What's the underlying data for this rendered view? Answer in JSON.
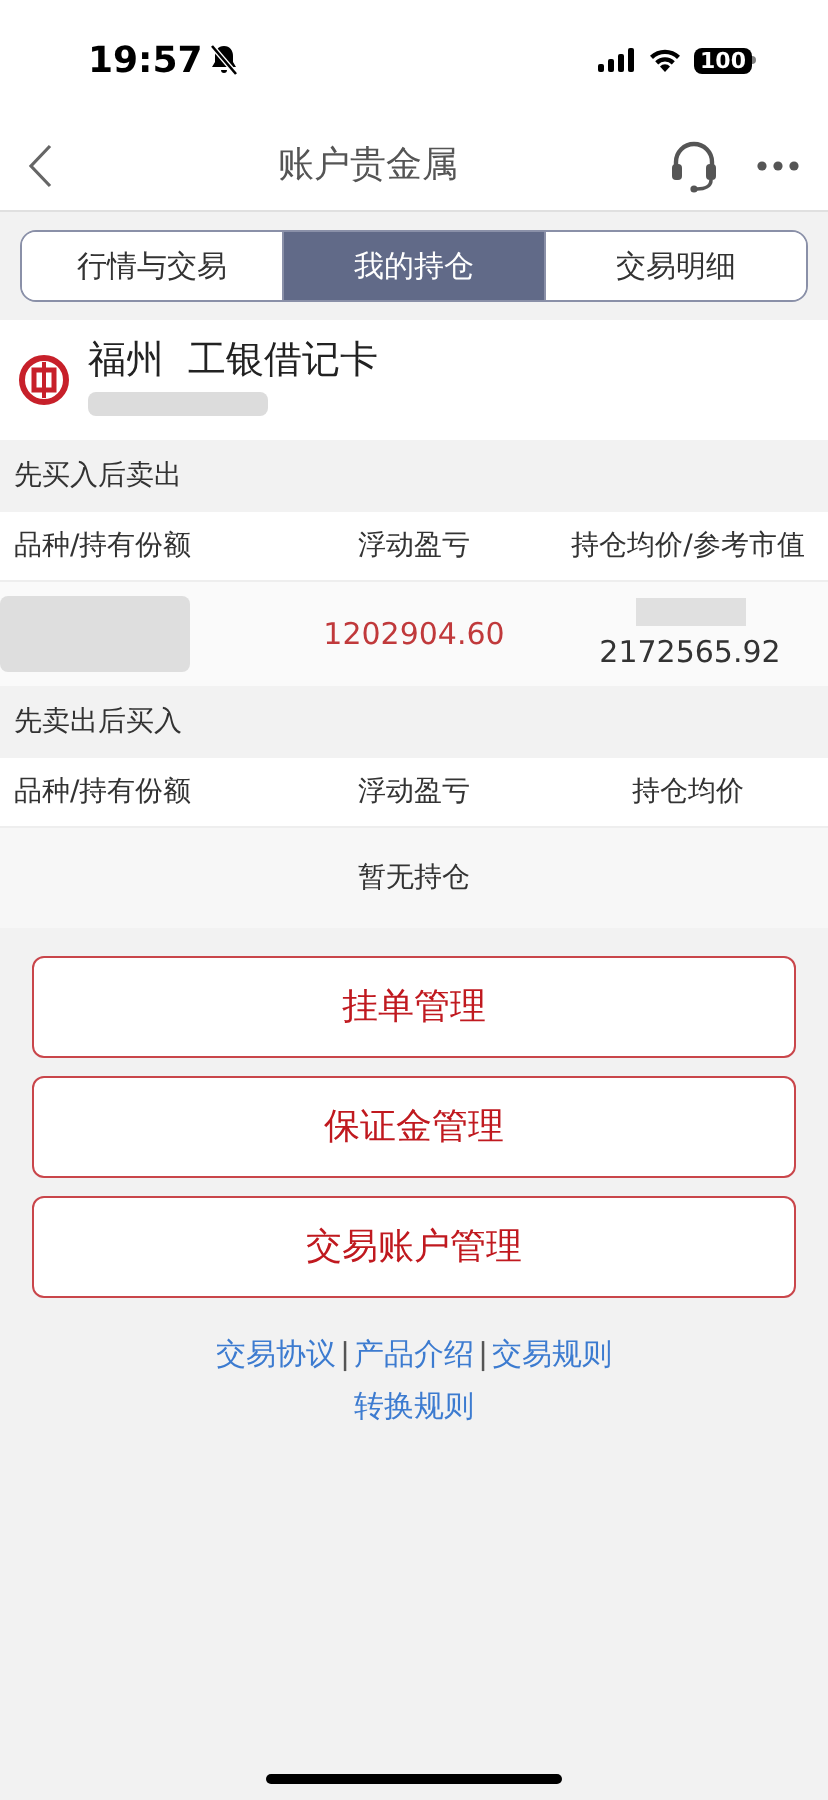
{
  "status_bar": {
    "time": "19:57",
    "battery": "100"
  },
  "nav": {
    "title": "账户贵金属"
  },
  "tabs": [
    {
      "label": "行情与交易",
      "selected": false
    },
    {
      "label": "我的持仓",
      "selected": true
    },
    {
      "label": "交易明细",
      "selected": false
    }
  ],
  "account": {
    "name": "福州  工银借记卡"
  },
  "sections": [
    {
      "title": "先买入后卖出",
      "columns": [
        "品种/持有份额",
        "浮动盈亏",
        "持仓均价/参考市值"
      ],
      "rows": [
        {
          "profit": "1202904.60",
          "market_value": "2172565.92"
        }
      ]
    },
    {
      "title": "先卖出后买入",
      "columns": [
        "品种/持有份额",
        "浮动盈亏",
        "持仓均价"
      ],
      "empty_text": "暂无持仓"
    }
  ],
  "buttons": [
    "挂单管理",
    "保证金管理",
    "交易账户管理"
  ],
  "footer_lines": [
    [
      {
        "kind": "link",
        "text": "交易协议"
      },
      {
        "kind": "separator",
        "text": "|"
      },
      {
        "kind": "link",
        "text": "产品介绍"
      },
      {
        "kind": "separator",
        "text": "|"
      },
      {
        "kind": "link",
        "text": "交易规则"
      }
    ],
    [
      {
        "kind": "link",
        "text": "转换规则"
      }
    ]
  ]
}
